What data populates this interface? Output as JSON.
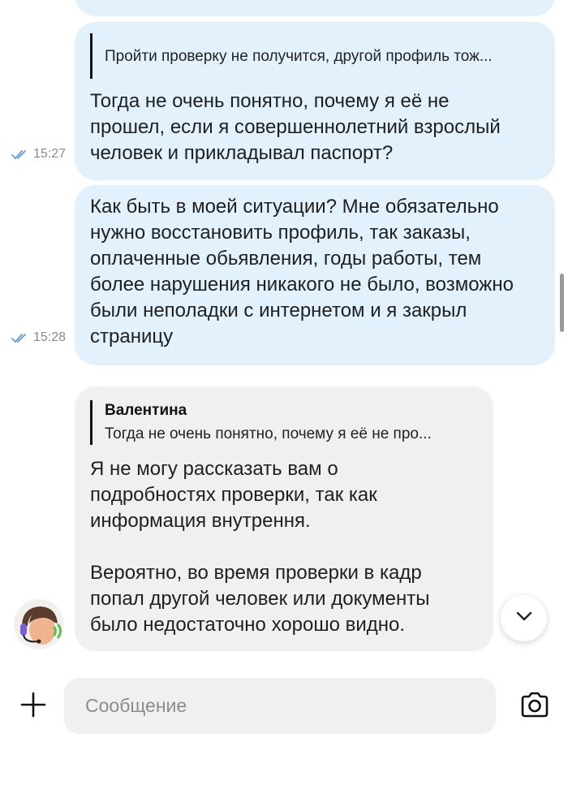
{
  "messages": [
    {
      "direction": "outgoing",
      "quote": "Пройти проверку не получится, другой профиль тож...",
      "text": "Тогда не очень понятно, почему я её не\nпрошел, если я совершеннолетний взрослый\nчеловек и прикладывал паспорт?",
      "time": "15:27",
      "status": "read"
    },
    {
      "direction": "outgoing",
      "text": "Как быть в моей ситуации? Мне обязательно\nнужно восстановить профиль, так заказы,\nоплаченные обьявления, годы работы, тем\nболее нарушения никакого не было, возможно\nбыли неполадки с интернетом и я закрыл\nстраницу",
      "time": "15:28",
      "status": "read"
    },
    {
      "direction": "incoming",
      "quote_author": "Валентина",
      "quote": "Тогда не очень понятно, почему я её не про...",
      "text": "Я не могу рассказать вам о\nподробностях проверки, так как\nинформация внутрення.\n\nВероятно, во время проверки в кадр\nпопал другой человек или документы\nбыло недостаточно хорошо видно."
    }
  ],
  "composer": {
    "placeholder": "Сообщение"
  },
  "icons": {
    "read_status": "double-check-icon",
    "add": "plus-icon",
    "camera": "camera-icon",
    "scroll_down": "chevron-down-icon",
    "avatar": "support-agent-avatar"
  },
  "colors": {
    "outgoing_bubble": "#e3f1fd",
    "incoming_bubble": "#f0f0f0",
    "read_check": "#5b9bd9",
    "time_text": "#8a8a8a"
  }
}
